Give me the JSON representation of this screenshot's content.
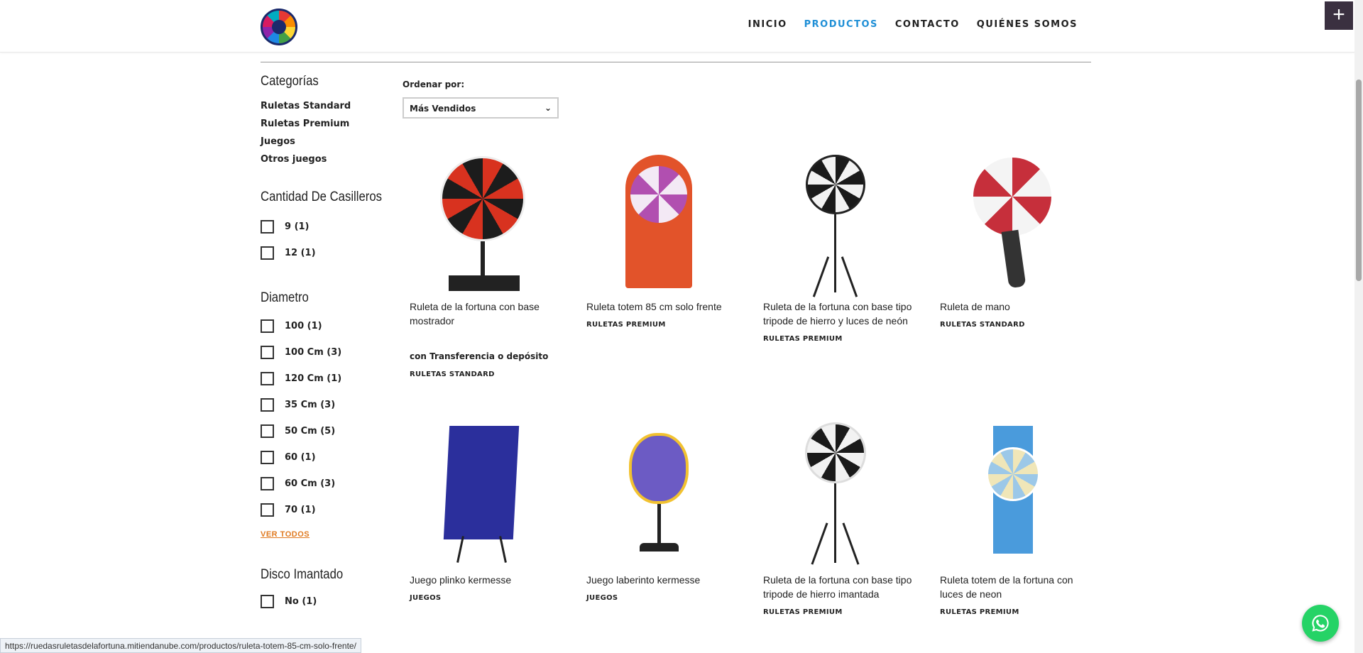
{
  "nav": {
    "items": [
      "INICIO",
      "PRODUCTOS",
      "CONTACTO",
      "QUIÉNES SOMOS"
    ],
    "active": "PRODUCTOS"
  },
  "sidebar": {
    "categories_title": "Categorías",
    "categories": [
      "Ruletas Standard",
      "Ruletas Premium",
      "Juegos",
      "Otros juegos"
    ],
    "casilleros_title": "Cantidad De Casilleros",
    "casilleros": [
      "9 (1)",
      "12 (1)"
    ],
    "diametro_title": "Diametro",
    "diametro": [
      "100 (1)",
      "100 Cm (3)",
      "120 Cm (1)",
      "35 Cm (3)",
      "50 Cm (5)",
      "60 (1)",
      "60 Cm (3)",
      "70 (1)"
    ],
    "ver_todos": "VER TODOS",
    "disco_title": "Disco Imantado",
    "disco": [
      "No (1)"
    ]
  },
  "sort": {
    "label": "Ordenar por:",
    "selected": "Más Vendidos"
  },
  "products": [
    {
      "name": "Ruleta de la fortuna con base mostrador",
      "category": "RULETAS STANDARD",
      "promo": "con Transferencia o depósito"
    },
    {
      "name": "Ruleta totem 85 cm solo frente",
      "category": "RULETAS PREMIUM"
    },
    {
      "name": "Ruleta de la fortuna con base tipo tripode de hierro y luces de neón",
      "category": "RULETAS PREMIUM"
    },
    {
      "name": "Ruleta de mano",
      "category": "RULETAS STANDARD"
    },
    {
      "name": "Juego plinko kermesse",
      "category": "JUEGOS"
    },
    {
      "name": "Juego laberinto kermesse",
      "category": "JUEGOS"
    },
    {
      "name": "Ruleta de la fortuna con base tipo tripode de hierro imantada",
      "category": "RULETAS PREMIUM"
    },
    {
      "name": "Ruleta totem de la fortuna con luces de neon",
      "category": "RULETAS PREMIUM"
    }
  ],
  "status_url": "https://ruedasruletasdelafortuna.mitiendanube.com/productos/ruleta-totem-85-cm-solo-frente/",
  "colors": {
    "accent": "#1f8fd6",
    "link_orange": "#e07a20",
    "whatsapp": "#25d366"
  }
}
